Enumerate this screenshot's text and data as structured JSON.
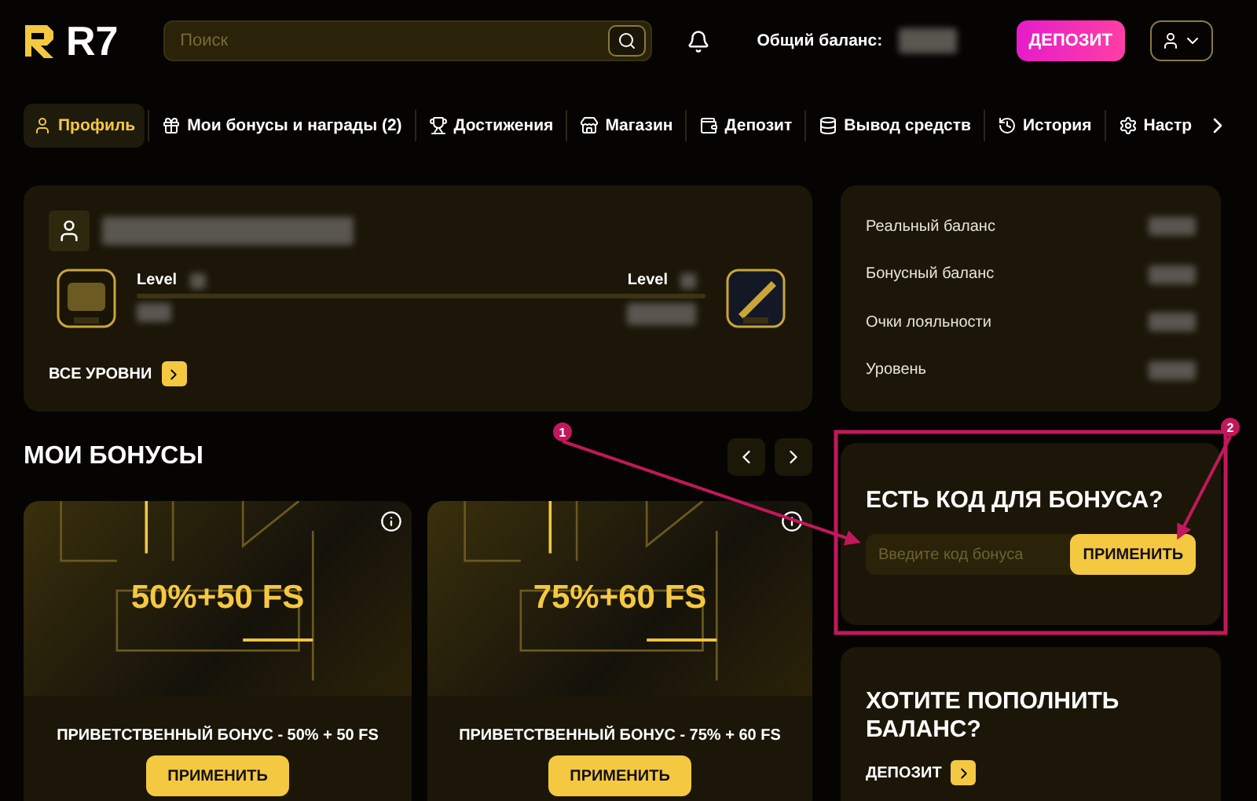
{
  "header": {
    "logo": "R7",
    "search": {
      "placeholder": "Поиск"
    },
    "balance_label": "Общий баланс:",
    "deposit_button": "ДЕПОЗИТ"
  },
  "nav_tabs": [
    {
      "label": "Профиль",
      "selected": true
    },
    {
      "label": "Мои бонусы и награды (2)",
      "selected": false
    },
    {
      "label": "Достижения",
      "selected": false
    },
    {
      "label": "Магазин",
      "selected": false
    },
    {
      "label": "Депозит",
      "selected": false
    },
    {
      "label": "Вывод средств",
      "selected": false
    },
    {
      "label": "История",
      "selected": false
    },
    {
      "label": "Настр",
      "selected": false
    }
  ],
  "profile": {
    "level_left": "Level",
    "level_right": "Level",
    "all_levels_link": "ВСЕ УРОВНИ"
  },
  "balance_rows": [
    {
      "label": "Реальный баланс"
    },
    {
      "label": "Бонусный баланс"
    },
    {
      "label": "Очки лояльности"
    },
    {
      "label": "Уровень"
    }
  ],
  "bonuses": {
    "title": "МОИ БОНУСЫ",
    "cards": [
      {
        "headline": "50%+50 FS",
        "name": "ПРИВЕТСТВЕННЫЙ БОНУС - 50% + 50 FS",
        "button": "ПРИМЕНИТЬ"
      },
      {
        "headline": "75%+60 FS",
        "name": "ПРИВЕТСТВЕННЫЙ БОНУС - 75% + 60 FS",
        "button": "ПРИМЕНИТЬ"
      }
    ]
  },
  "bonus_code": {
    "title": "ЕСТЬ КОД ДЛЯ БОНУСА?",
    "placeholder": "Введите код бонуса",
    "button": "ПРИМЕНИТЬ"
  },
  "top_up": {
    "title": "ХОТИТЕ ПОПОЛНИТЬ БАЛАНС?",
    "link": "ДЕПОЗИТ"
  },
  "annotations": [
    {
      "number": "1"
    },
    {
      "number": "2"
    }
  ]
}
